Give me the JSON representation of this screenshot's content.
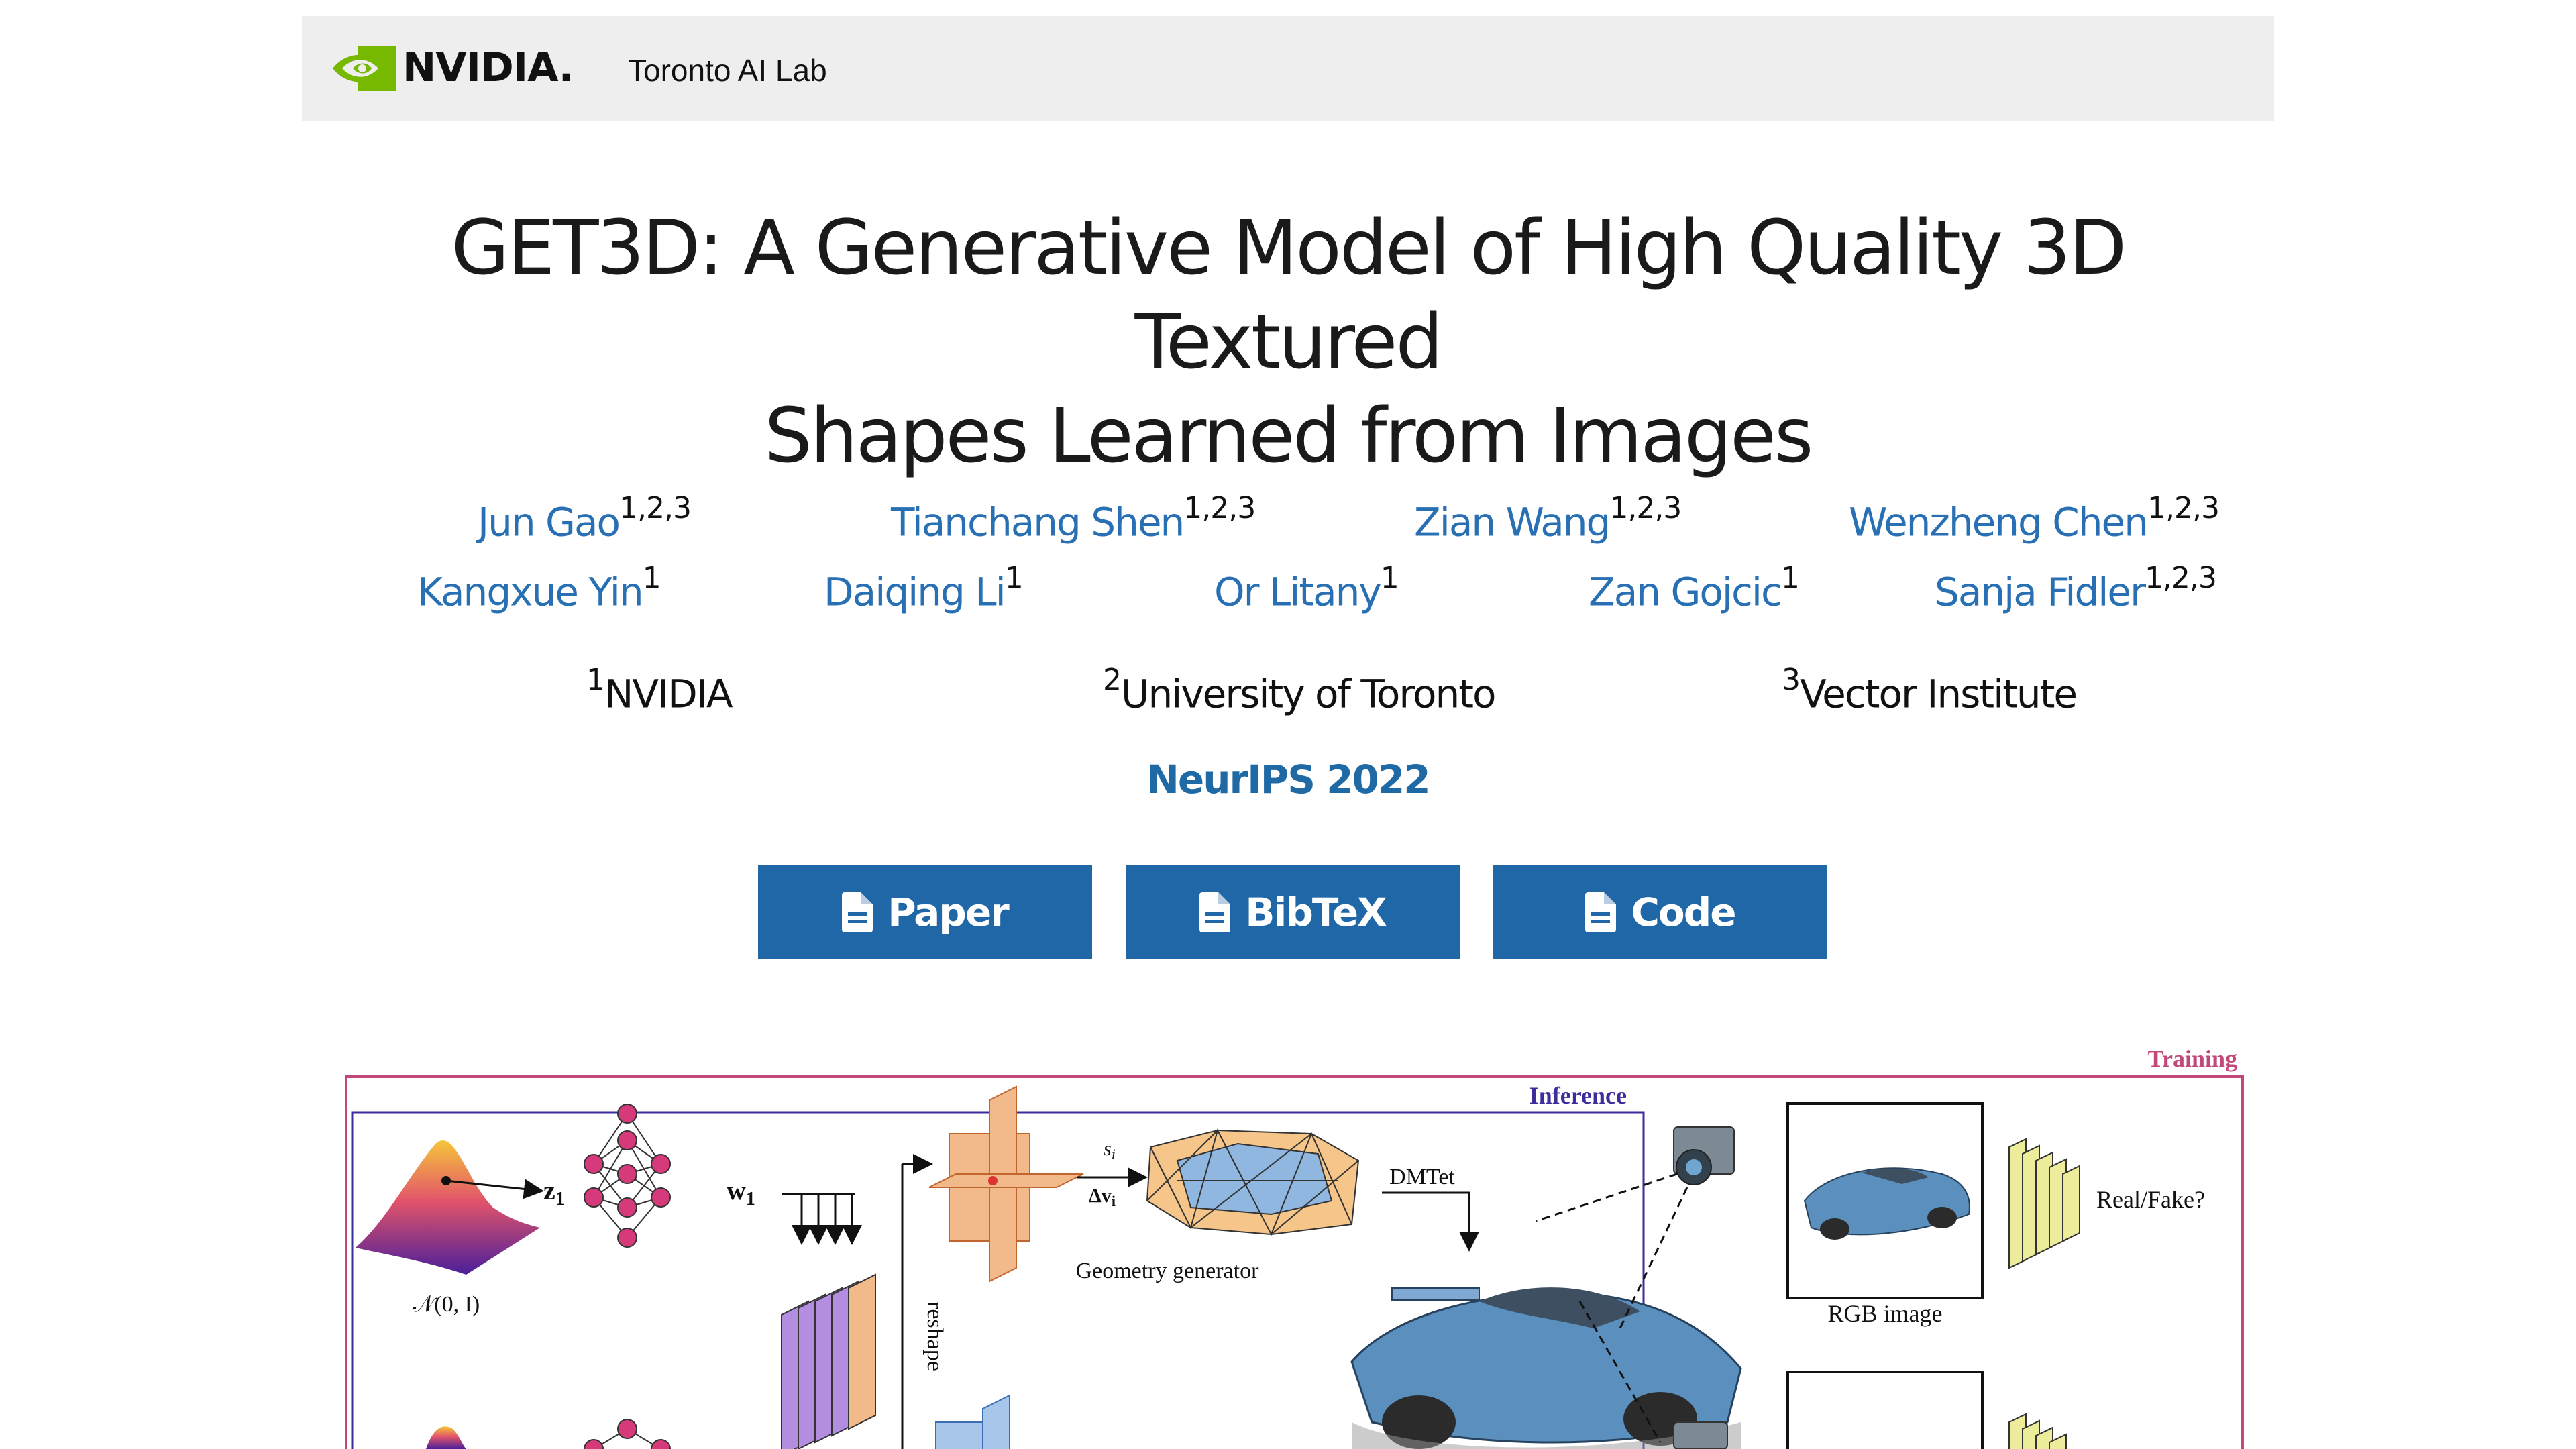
{
  "header": {
    "brand": "NVIDIA.",
    "lab": "Toronto AI Lab"
  },
  "page": {
    "title_line1": "GET3D: A Generative Model of High Quality 3D Textured",
    "title_line2": "Shapes Learned from Images"
  },
  "authors": [
    {
      "name": "Jun Gao",
      "sup": "1,2,3"
    },
    {
      "name": "Tianchang Shen",
      "sup": "1,2,3"
    },
    {
      "name": "Zian Wang",
      "sup": "1,2,3"
    },
    {
      "name": "Wenzheng Chen",
      "sup": "1,2,3"
    },
    {
      "name": "Kangxue Yin",
      "sup": "1"
    },
    {
      "name": "Daiqing Li",
      "sup": "1"
    },
    {
      "name": "Or Litany",
      "sup": "1"
    },
    {
      "name": "Zan Gojcic",
      "sup": "1"
    },
    {
      "name": "Sanja Fidler",
      "sup": "1,2,3"
    }
  ],
  "affiliations": [
    {
      "sup": "1",
      "name": "NVIDIA"
    },
    {
      "sup": "2",
      "name": "University of Toronto"
    },
    {
      "sup": "3",
      "name": "Vector Institute"
    }
  ],
  "venue": "NeurIPS 2022",
  "buttons": [
    {
      "label": "Paper",
      "icon": "file-icon"
    },
    {
      "label": "BibTeX",
      "icon": "file-icon"
    },
    {
      "label": "Code",
      "icon": "file-icon"
    }
  ],
  "figure": {
    "training_label": "Training",
    "inference_label": "Inference",
    "z1": "z",
    "z1_sub": "1",
    "w1": "w",
    "w1_sub": "1",
    "normal_label": "𝒩(0, I)",
    "reshape_label": "reshape",
    "geometry_generator_label": "Geometry generator",
    "si_label": "s",
    "si_sub": "i",
    "dv_label": "Δv",
    "dv_sub": "i",
    "dmtet_label": "DMTet",
    "rgb_label": "RGB image",
    "realfake_label": "Real/Fake?"
  },
  "colors": {
    "link_blue": "#2870b3",
    "button_blue": "#1f67a7",
    "nvidia_green": "#76b900",
    "training_pink": "#c2477a",
    "inference_purple": "#3b2d9c"
  }
}
